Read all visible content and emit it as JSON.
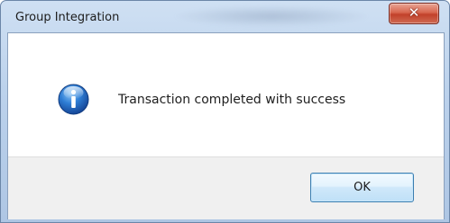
{
  "window": {
    "title": "Group Integration",
    "close_icon": "close-icon"
  },
  "dialog": {
    "icon": "info-icon",
    "message": "Transaction completed with success"
  },
  "buttons": {
    "ok_label": "OK"
  },
  "colors": {
    "title_bar": "#bcd2ec",
    "close_button": "#c2412a",
    "info_icon": "#1f5fb8",
    "button_bar": "#f0f0f0",
    "ok_border": "#3c7fb1"
  }
}
